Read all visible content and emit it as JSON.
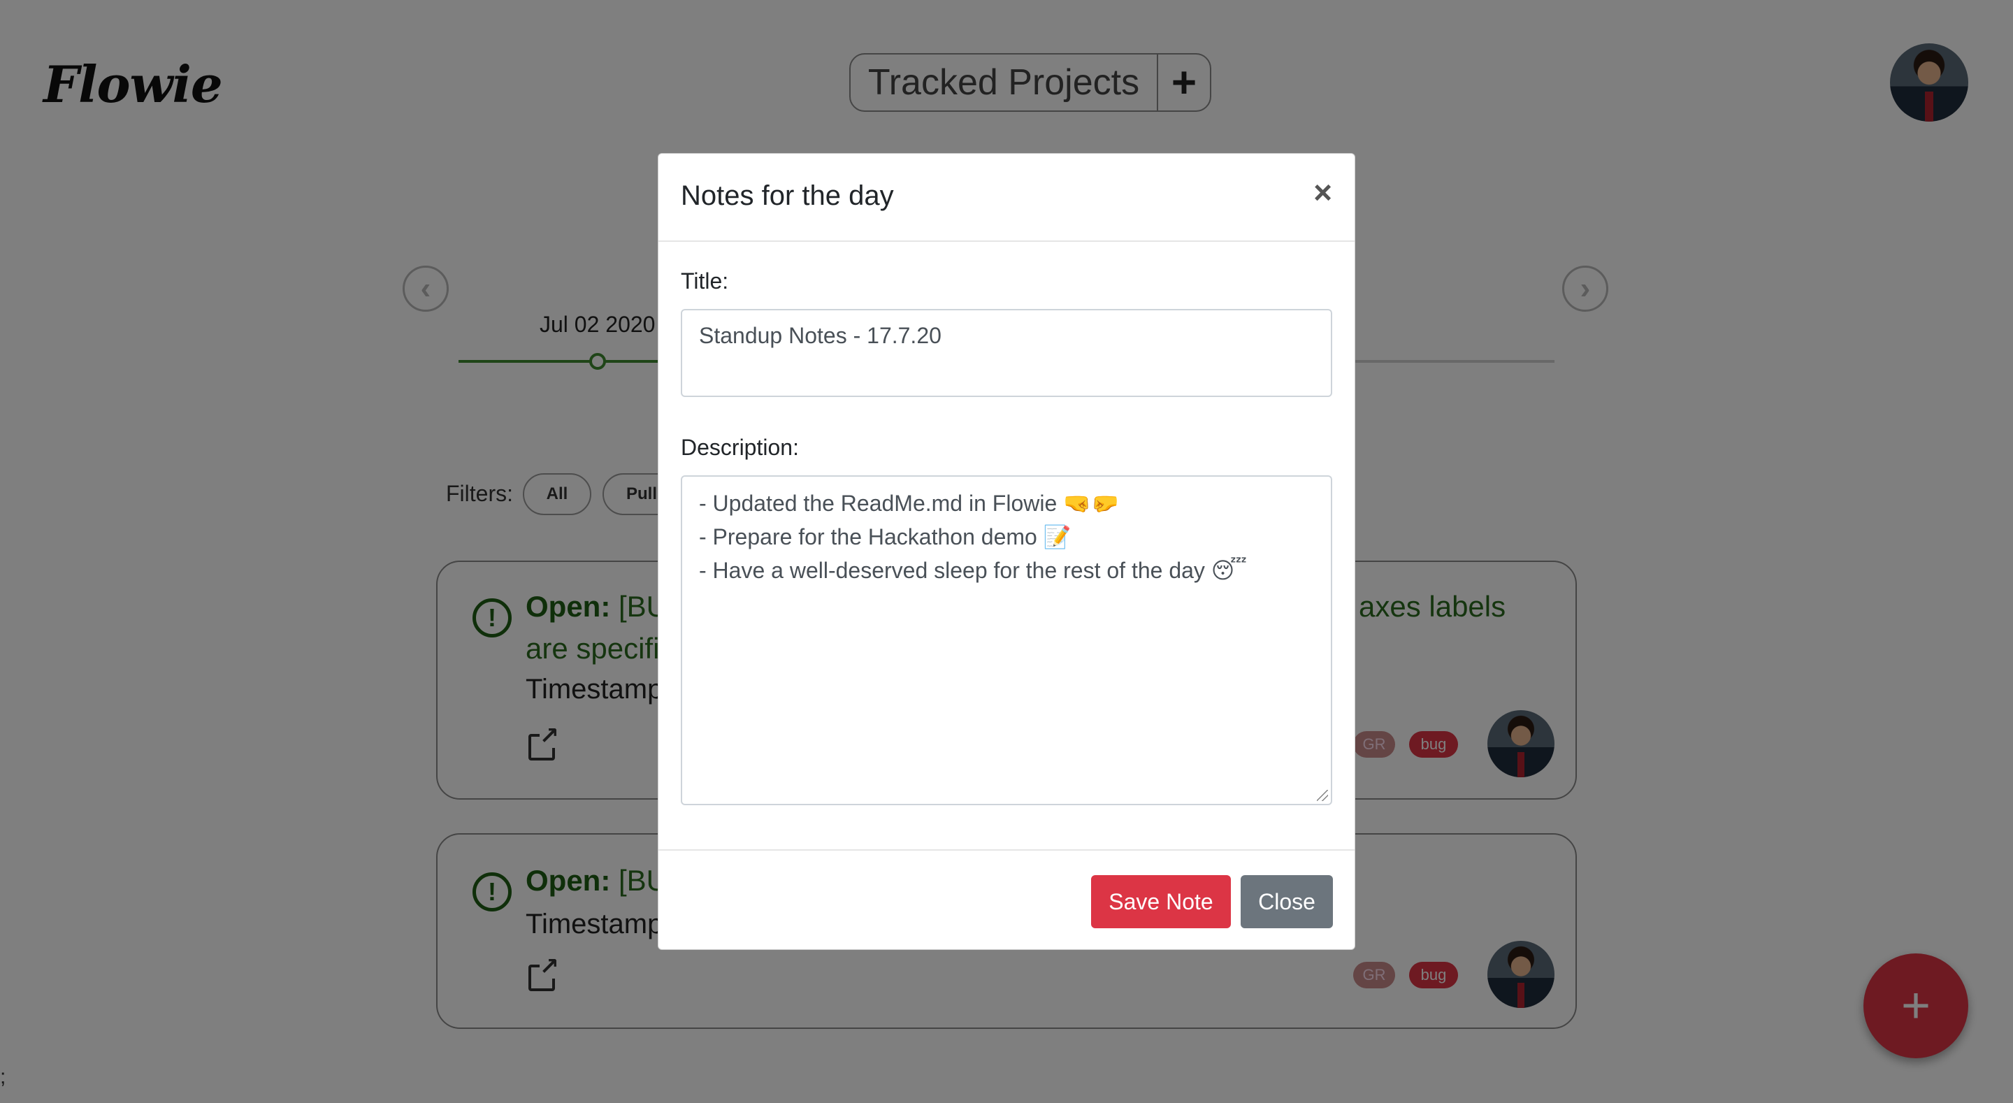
{
  "app": {
    "logo": "Flowie"
  },
  "header": {
    "tracked_projects_label": "Tracked Projects",
    "add_symbol": "+"
  },
  "timeline": {
    "prev_symbol": "‹",
    "next_symbol": "›",
    "visible_date": "Jul 02 2020"
  },
  "filters": {
    "label": "Filters:",
    "chips": [
      "All",
      "Pull"
    ]
  },
  "cards": [
    {
      "status": "Open:",
      "title_visible_left": "[BU",
      "title_line2_left": "are specifi",
      "title_visible_right": "axes labels",
      "timestamp_prefix": "Timestamp",
      "badges": [
        "GR",
        "bug"
      ]
    },
    {
      "status": "Open:",
      "title_visible_left": "[BU",
      "timestamp_prefix": "Timestamp",
      "badges": [
        "GR",
        "bug"
      ]
    }
  ],
  "fab": {
    "symbol": "+"
  },
  "stray_text": ";",
  "modal": {
    "title": "Notes for the day",
    "close_symbol": "×",
    "title_label": "Title:",
    "title_value": "Standup Notes - 17.7.20",
    "description_label": "Description:",
    "description_lines": [
      "- Updated the ReadMe.md in Flowie 🤜🤛",
      "- Prepare for the Hackathon demo 📝",
      "- Have a well-deserved sleep for the rest of the day 😴"
    ],
    "save_button": "Save Note",
    "close_button": "Close"
  },
  "colors": {
    "primary_red": "#dc3545",
    "secondary_gray": "#6c757d",
    "open_green": "#1f5f14",
    "backdrop": "rgba(0,0,0,0.5)"
  }
}
